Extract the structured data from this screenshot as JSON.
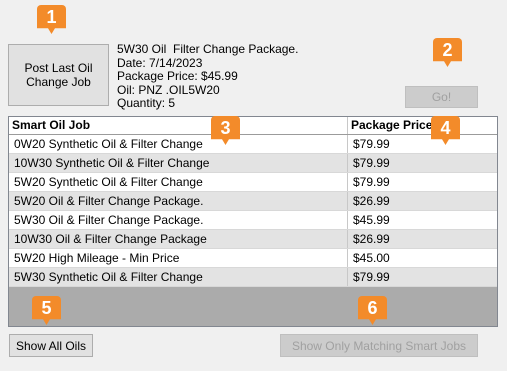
{
  "post_button": {
    "label": "Post Last Oil\nChange Job"
  },
  "go_button": {
    "label": "Go!"
  },
  "package_info": {
    "line1": "5W30 Oil  Filter Change Package.",
    "line2": "Date: 7/14/2023",
    "line3": "Package Price: $45.99",
    "line4": "Oil: PNZ .OIL5W20",
    "line5": "Quantity: 5"
  },
  "grid": {
    "headers": {
      "job": "Smart Oil Job",
      "price": "Package Price"
    },
    "rows": [
      {
        "job": "0W20 Synthetic Oil & Filter Change",
        "price": "$79.99"
      },
      {
        "job": "10W30 Synthetic Oil & Filter Change",
        "price": "$79.99"
      },
      {
        "job": "5W20 Synthetic Oil & Filter Change",
        "price": "$79.99"
      },
      {
        "job": "5W20 Oil & Filter Change Package.",
        "price": "$26.99"
      },
      {
        "job": "5W30 Oil & Filter Change Package.",
        "price": "$45.99"
      },
      {
        "job": "10W30 Oil & Filter Change Package",
        "price": "$26.99"
      },
      {
        "job": "5W20 High Mileage - Min Price",
        "price": "$45.00"
      },
      {
        "job": "5W30 Synthetic Oil & Filter Change",
        "price": "$79.99"
      }
    ]
  },
  "show_all_button": {
    "label": "Show All Oils"
  },
  "matching_button": {
    "label": "Show Only Matching Smart Jobs"
  },
  "badges": {
    "b1": "1",
    "b2": "2",
    "b3": "3",
    "b4": "4",
    "b5": "5",
    "b6": "6"
  },
  "colors": {
    "badge": "#f38b2a",
    "window": "#f0f0f0",
    "alt_row": "#e3e3e3"
  }
}
